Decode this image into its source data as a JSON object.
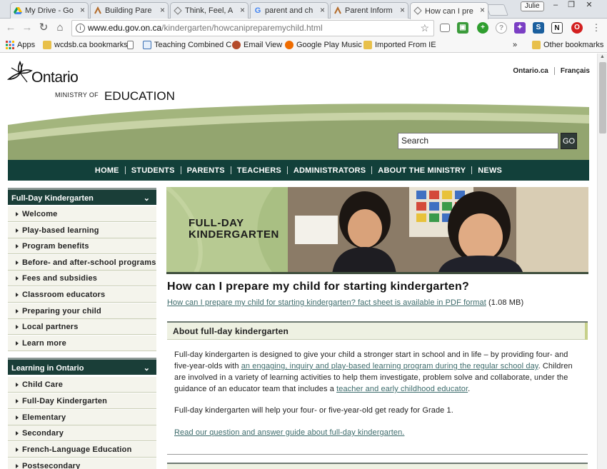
{
  "browser": {
    "tabs": [
      {
        "title": "My Drive - Go",
        "icon": "google-drive-icon",
        "active": false
      },
      {
        "title": "Building Pare",
        "icon": "page-icon",
        "active": false
      },
      {
        "title": "Think, Feel, A",
        "icon": "page-icon",
        "active": false
      },
      {
        "title": "parent and ch",
        "icon": "google-icon",
        "active": false
      },
      {
        "title": "Parent Inform",
        "icon": "page-icon",
        "active": false
      },
      {
        "title": "How can I pre",
        "icon": "page-icon",
        "active": true
      }
    ],
    "user_badge": "Julie",
    "url_domain": "www.edu.gov.on.ca",
    "url_path": "/kindergarten/howcanipreparemychild.html",
    "bookmarks": [
      {
        "label": "Apps",
        "icon": "apps-grid-icon"
      },
      {
        "label": "wcdsb.ca bookmarks",
        "icon": "folder-icon"
      },
      {
        "label": "",
        "icon": "page-icon"
      },
      {
        "label": "Teaching Combined C",
        "icon": "page-icon"
      },
      {
        "label": "Email View",
        "icon": "email-icon"
      },
      {
        "label": "Google Play Music",
        "icon": "play-music-icon"
      },
      {
        "label": "Imported From IE",
        "icon": "folder-icon"
      }
    ],
    "bookmarks_more": "»",
    "other_bookmarks": "Other bookmarks"
  },
  "site": {
    "logo_word": "Ontario",
    "ministry_of": "MINISTRY OF",
    "ministry_name": "EDUCATION",
    "top_links": [
      "Ontario.ca",
      "Français"
    ],
    "search_placeholder": "Search",
    "search_button": "GO",
    "nav": [
      "HOME",
      "STUDENTS",
      "PARENTS",
      "TEACHERS",
      "ADMINISTRATORS",
      "ABOUT THE MINISTRY",
      "NEWS"
    ],
    "colors": {
      "nav_bg": "#12403a",
      "accent_green": "#a9bf83",
      "link": "#3c6b6b"
    }
  },
  "sidebar": {
    "section1": {
      "title": "Full-Day Kindergarten",
      "items": [
        "Welcome",
        "Play-based learning",
        "Program benefits",
        "Before- and after-school programs",
        "Fees and subsidies",
        "Classroom educators",
        "Preparing your child",
        "Local partners",
        "Learn more"
      ]
    },
    "section2": {
      "title": "Learning in Ontario",
      "items": [
        "Child Care",
        "Full-Day Kindergarten",
        "Elementary",
        "Secondary",
        "French-Language Education",
        "Postsecondary"
      ]
    }
  },
  "main": {
    "banner_title_line1": "FULL-DAY",
    "banner_title_line2": "KINDERGARTEN",
    "page_title": "How can I prepare my child for starting kindergarten?",
    "pdf_link": "How can I prepare my child for starting kindergarten? fact sheet is available in PDF format",
    "pdf_size": "(1.08 MB)",
    "section_title": "About full-day kindergarten",
    "para1_a": "Full-day kindergarten is designed to give your child a stronger start in school and in life – by providing four- and five-year-olds with ",
    "para1_link1": "an engaging, inquiry and play-based learning program during the regular school day",
    "para1_b": ". Children are involved in a variety of learning activities to help them investigate, problem solve and collaborate, under the guidance of an educator team that includes a ",
    "para1_link2": "teacher and early childhood educator",
    "para1_c": ".",
    "para2": "Full-day kindergarten will help your four- or five-year-old get ready for Grade 1.",
    "qa_link": "Read our question and answer guide about full-day kindergarten."
  }
}
